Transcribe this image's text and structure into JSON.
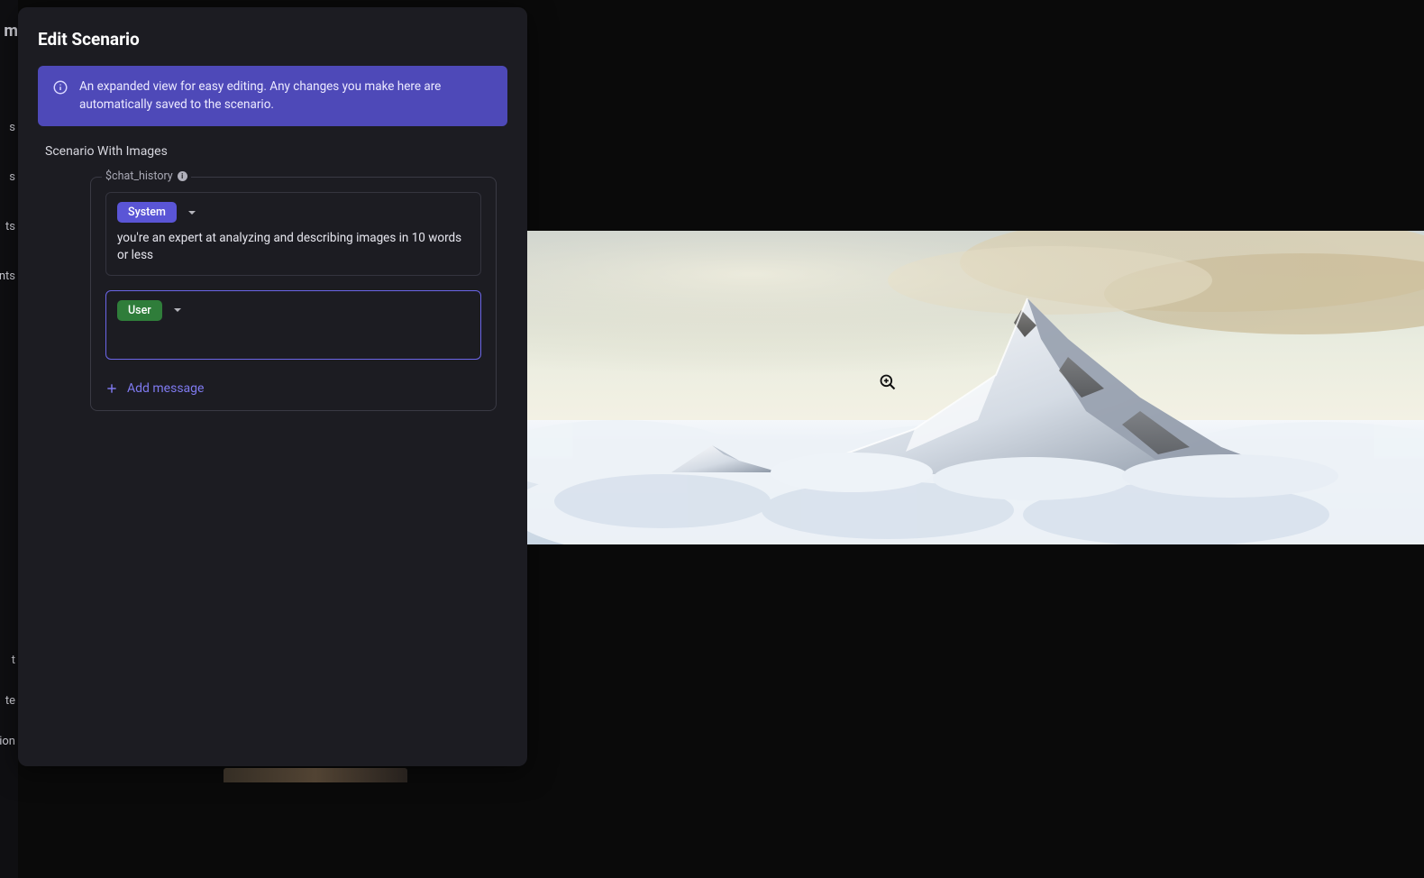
{
  "sidebar": {
    "brand_fragment": "u m",
    "items": [
      "s",
      "s",
      "ts",
      "nts"
    ],
    "bottom": {
      "item_t": "t",
      "item_te": "te",
      "item_ion": "ion"
    }
  },
  "panel": {
    "title": "Edit Scenario",
    "banner_text": "An expanded view for easy editing. Any changes you make here are automatically saved to the scenario.",
    "scenario_name": "Scenario With Images",
    "chat_var": "$chat_history",
    "messages": [
      {
        "role": "System",
        "content": "you're an expert at analyzing and describing images in 10 words or less"
      },
      {
        "role": "User",
        "content": ""
      }
    ],
    "add_message_label": "Add message"
  },
  "image_viewer": {
    "subject": "snow-covered mountain peak rising above cloud layer under soft sunlit sky",
    "cursor_tool": "zoom-in"
  }
}
